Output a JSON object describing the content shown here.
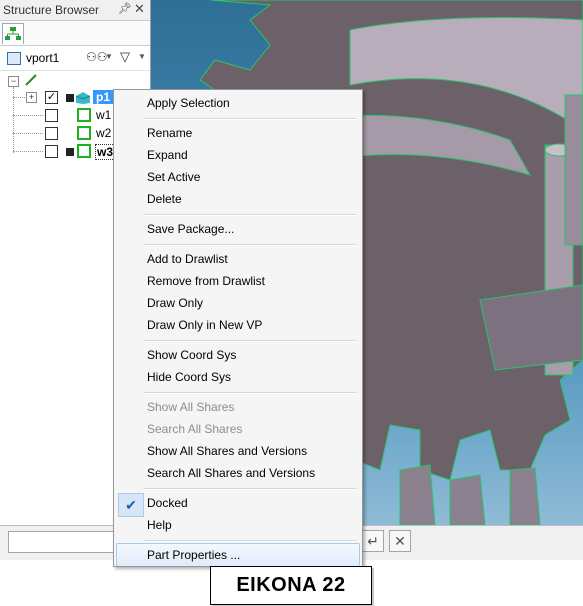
{
  "browser": {
    "title": "Structure Browser",
    "viewport_label": "vport1",
    "tree": [
      {
        "label": "p1",
        "checked": true
      },
      {
        "label": "w1",
        "checked": false
      },
      {
        "label": "w2",
        "checked": false
      },
      {
        "label": "w3",
        "checked": false
      }
    ]
  },
  "context_menu": {
    "items": [
      {
        "label": "Apply Selection",
        "enabled": true
      },
      {
        "label": "Rename",
        "enabled": true
      },
      {
        "label": "Expand",
        "enabled": true
      },
      {
        "label": "Set Active",
        "enabled": true
      },
      {
        "label": "Delete",
        "enabled": true
      },
      {
        "label": "Save Package...",
        "enabled": true
      },
      {
        "label": "Add to Drawlist",
        "enabled": true
      },
      {
        "label": "Remove from Drawlist",
        "enabled": true
      },
      {
        "label": "Draw Only",
        "enabled": true
      },
      {
        "label": "Draw Only in New VP",
        "enabled": true
      },
      {
        "label": "Show Coord Sys",
        "enabled": true
      },
      {
        "label": "Hide Coord Sys",
        "enabled": true
      },
      {
        "label": "Show All Shares",
        "enabled": false
      },
      {
        "label": "Search All Shares",
        "enabled": false
      },
      {
        "label": "Show All Shares and Versions",
        "enabled": true
      },
      {
        "label": "Search All Shares and Versions",
        "enabled": true
      },
      {
        "label": "Docked",
        "enabled": true,
        "checked": true
      },
      {
        "label": "Help",
        "enabled": true
      },
      {
        "label": "Part Properties ...",
        "enabled": true,
        "hovered": true
      }
    ]
  },
  "caption": "EIKONA 22",
  "colors": {
    "menu_bg": "#f5f5f5",
    "selection_blue": "#3399ff",
    "model_grey": "#9a8f9c",
    "edge_green": "#2ecc71",
    "sky_top": "#2f6f96",
    "sky_bottom": "#8fbbd6"
  },
  "icons": [
    "pin-icon",
    "close-icon",
    "tree-icon",
    "viewport-icon",
    "binoculars-icon",
    "filter-icon",
    "check-icon",
    "enter-icon",
    "cancel-icon"
  ]
}
